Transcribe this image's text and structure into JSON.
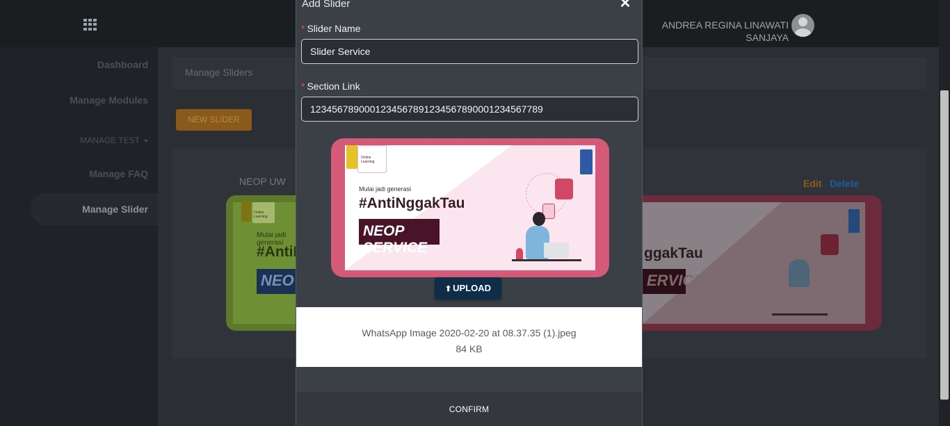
{
  "header": {
    "user_name_line1": "ANDREA REGINA LINAWATI",
    "user_name_line2": "SANJAYA"
  },
  "sidebar": {
    "items": [
      {
        "label": "Dashboard"
      },
      {
        "label": "Manage Modules"
      },
      {
        "label": "MANAGE TEST"
      },
      {
        "label": "Manage FAQ"
      },
      {
        "label": "Manage Slider"
      }
    ]
  },
  "page": {
    "breadcrumb": "Manage Sliders",
    "new_button": "NEW SLIDER",
    "cards": [
      {
        "title": "NEOP UW",
        "image_text_small": "Mulai jadi generasi",
        "image_text_hashtag": "#AntiN",
        "image_text_banner": "NEO",
        "image_logo_text": "Online Learning"
      },
      {
        "edit_label": "Edit",
        "delete_label": "Delete",
        "image_text_hashtag": "ggakTau",
        "image_text_banner": "ERVICE"
      }
    ]
  },
  "modal": {
    "title": "Add Slider",
    "close_glyph": "✕",
    "fields": {
      "slider_name": {
        "label": "Slider Name",
        "required_mark": "*",
        "value": "Slider Service"
      },
      "section_link": {
        "label": "Section Link",
        "required_mark": "*",
        "value": "1234567890001234567891234567890001234567789"
      }
    },
    "preview": {
      "text_small": "Mulai jadi generasi",
      "text_hashtag": "#AntiNggakTau",
      "text_banner": "NEOP SERVICE",
      "logo_text": "Online Learning"
    },
    "upload": {
      "label": "UPLOAD",
      "icon_glyph": "⬆"
    },
    "file": {
      "name": "WhatsApp Image 2020-02-20 at 08.37.35 (1).jpeg",
      "size": "84 KB"
    },
    "confirm_label": "CONFIRM"
  },
  "colors": {
    "topbar_bg": "#1b1e21",
    "modal_bg": "#3b4046",
    "new_button": "#8a5a1b",
    "upload_button": "#0f2c49",
    "preview_frame": "#d55978",
    "required": "#e05050"
  },
  "icons": {
    "apps": "apps-grid-icon",
    "avatar": "user-avatar-icon",
    "close": "close-icon",
    "upload": "upload-icon",
    "caret": "caret-down-icon"
  }
}
